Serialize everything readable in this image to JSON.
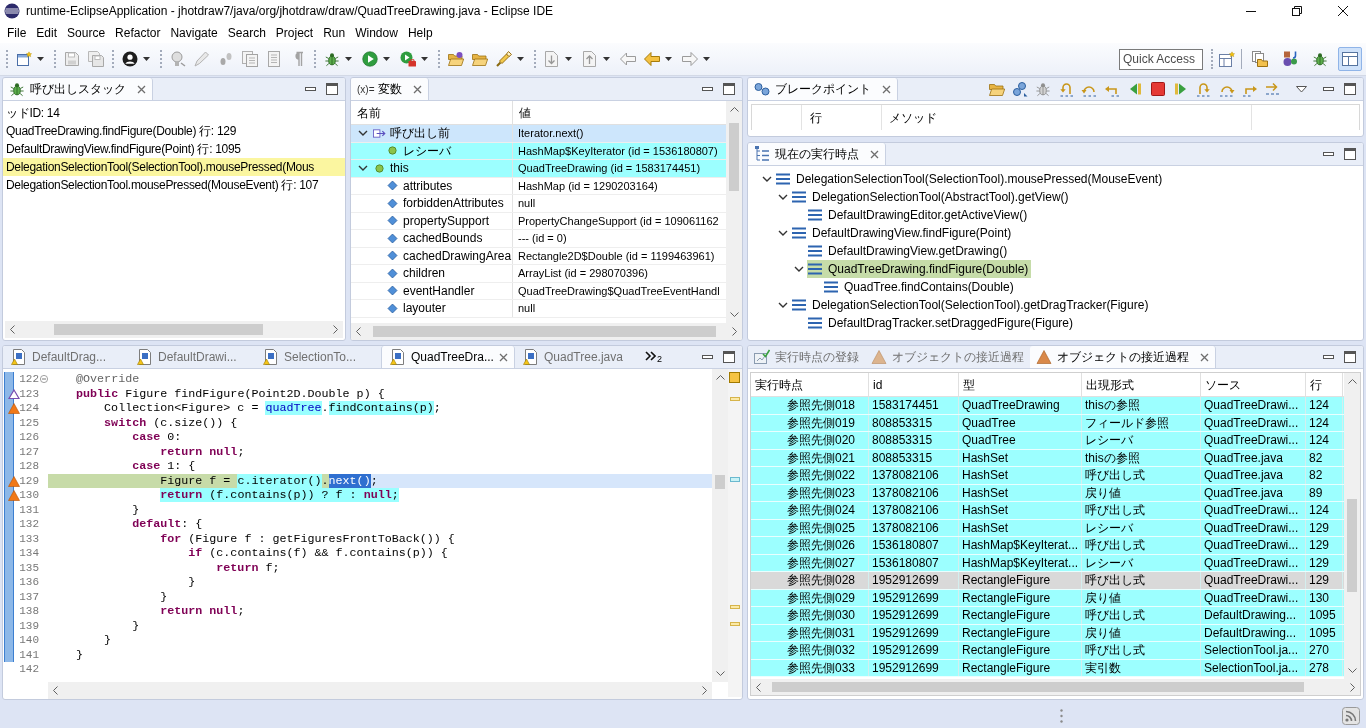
{
  "window": {
    "title": "runtime-EclipseApplication - jhotdraw7/java/org/jhotdraw/draw/QuadTreeDrawing.java - Eclipse IDE"
  },
  "menu": [
    "File",
    "Edit",
    "Source",
    "Refactor",
    "Navigate",
    "Search",
    "Project",
    "Run",
    "Window",
    "Help"
  ],
  "toolbar": {
    "quick_access": {
      "placeholder": "Quick Access"
    },
    "perspectives": [
      {
        "selected": false
      },
      {
        "selected": false
      },
      {
        "selected": false
      },
      {
        "selected": true
      }
    ]
  },
  "call_stack": {
    "title": "呼び出しスタック",
    "frames": [
      {
        "text": "ッドID: 14",
        "selected": false
      },
      {
        "text": "QuadTreeDrawing.findFigure(Double) 行: 129",
        "selected": false
      },
      {
        "text": "DefaultDrawingView.findFigure(Point) 行: 1095",
        "selected": false
      },
      {
        "text": "DelegationSelectionTool(SelectionTool).mousePressed(Mous",
        "selected": true
      },
      {
        "text": "DelegationSelectionTool.mousePressed(MouseEvent) 行: 107",
        "selected": false
      }
    ]
  },
  "variables": {
    "glyph": "(x)=",
    "title": "変数",
    "columns": [
      "名前",
      "値"
    ],
    "rows": [
      {
        "kind": "return",
        "name": "呼び出し前",
        "value": "Iterator.next()",
        "selected": true,
        "highlighted": false,
        "expanded": true,
        "children": [
          {
            "kind": "local",
            "name": "レシーバ",
            "value": "HashMap$KeyIterator (id = 1536180807)",
            "selected": false,
            "highlighted": true
          }
        ]
      },
      {
        "kind": "local",
        "name": "this",
        "value": "QuadTreeDrawing (id = 1583174451)",
        "selected": false,
        "highlighted": true,
        "expanded": true,
        "children": [
          {
            "kind": "field",
            "name": "attributes",
            "value": "HashMap (id = 1290203164)",
            "selected": false,
            "highlighted": false
          },
          {
            "kind": "field",
            "name": "forbiddenAttributes",
            "value": "null",
            "selected": false,
            "highlighted": false
          },
          {
            "kind": "field",
            "name": "propertySupport",
            "value": "PropertyChangeSupport (id = 109061162",
            "selected": false,
            "highlighted": false
          },
          {
            "kind": "field",
            "name": "cachedBounds",
            "value": "--- (id = 0)",
            "selected": false,
            "highlighted": false
          },
          {
            "kind": "field",
            "name": "cachedDrawingArea",
            "value": "Rectangle2D$Double (id = 1199463961)",
            "selected": false,
            "highlighted": false
          },
          {
            "kind": "field",
            "name": "children",
            "value": "ArrayList (id = 298070396)",
            "selected": false,
            "highlighted": false
          },
          {
            "kind": "field",
            "name": "eventHandler",
            "value": "QuadTreeDrawing$QuadTreeEventHandl",
            "selected": false,
            "highlighted": false
          },
          {
            "kind": "field",
            "name": "layouter",
            "value": "null",
            "selected": false,
            "highlighted": false
          }
        ]
      }
    ]
  },
  "breakpoints": {
    "title": "ブレークポイント",
    "columns": [
      "行",
      "メソッド"
    ]
  },
  "execution_point": {
    "title": "現在の実行時点",
    "tree": [
      {
        "label": "DelegationSelectionTool(SelectionTool).mousePressed(MouseEvent)",
        "selected": false,
        "expanded": true,
        "children": [
          {
            "label": "DelegationSelectionTool(AbstractTool).getView()",
            "selected": false,
            "expanded": true,
            "children": [
              {
                "label": "DefaultDrawingEditor.getActiveView()",
                "selected": false
              }
            ]
          },
          {
            "label": "DefaultDrawingView.findFigure(Point)",
            "selected": false,
            "expanded": true,
            "children": [
              {
                "label": "DefaultDrawingView.getDrawing()",
                "selected": false
              },
              {
                "label": "QuadTreeDrawing.findFigure(Double)",
                "selected": true,
                "expanded": true,
                "children": [
                  {
                    "label": "QuadTree.findContains(Double)",
                    "selected": false
                  }
                ]
              }
            ]
          },
          {
            "label": "DelegationSelectionTool(SelectionTool).getDragTracker(Figure)",
            "selected": false,
            "expanded": true,
            "children": [
              {
                "label": "DefaultDragTracker.setDraggedFigure(Figure)",
                "selected": false
              }
            ]
          }
        ]
      }
    ]
  },
  "editor": {
    "tabs": [
      {
        "label": "DefaultDrag...",
        "selected": false
      },
      {
        "label": "DefaultDrawi...",
        "selected": false
      },
      {
        "label": "SelectionTo...",
        "selected": false
      },
      {
        "label": "QuadTreeDra...",
        "selected": true
      },
      {
        "label": "QuadTree.java",
        "selected": false
      }
    ],
    "hidden_tab_count": "2",
    "lines": [
      {
        "number": "122",
        "kind": "fold",
        "current": false,
        "tokens": [
          {
            "text": "    @Override",
            "kind": "annotation"
          }
        ]
      },
      {
        "number": "123",
        "kind": "override",
        "current": false,
        "tokens": [
          {
            "text": "    public",
            "kind": "keyword"
          },
          {
            "text": " Figure findFigure(Point2D.Double p) {",
            "kind": "plain"
          }
        ]
      },
      {
        "number": "124",
        "kind": "approach",
        "current": false,
        "tokens": [
          {
            "text": "        Collection<Figure> c = ",
            "kind": "plain"
          },
          {
            "text": "quadTree",
            "kind": "field-match"
          },
          {
            "text": ".",
            "kind": "plain"
          },
          {
            "text": "findContains(p)",
            "kind": "plain-match"
          },
          {
            "text": ";",
            "kind": "plain"
          }
        ]
      },
      {
        "number": "125",
        "kind": "plain",
        "current": false,
        "tokens": [
          {
            "text": "        switch",
            "kind": "keyword"
          },
          {
            "text": " (c.size()) {",
            "kind": "plain"
          }
        ]
      },
      {
        "number": "126",
        "kind": "plain",
        "current": false,
        "tokens": [
          {
            "text": "            case",
            "kind": "keyword"
          },
          {
            "text": " 0:",
            "kind": "plain"
          }
        ]
      },
      {
        "number": "127",
        "kind": "plain",
        "current": false,
        "tokens": [
          {
            "text": "                return null",
            "kind": "keyword"
          },
          {
            "text": ";",
            "kind": "plain"
          }
        ]
      },
      {
        "number": "128",
        "kind": "plain",
        "current": false,
        "tokens": [
          {
            "text": "            case",
            "kind": "keyword"
          },
          {
            "text": " 1: {",
            "kind": "plain"
          }
        ]
      },
      {
        "number": "129",
        "kind": "approach",
        "current": true,
        "tokens": [
          {
            "text": "                Figure f = ",
            "kind": "plain-current"
          },
          {
            "text": "c.iterator()",
            "kind": "plain-match"
          },
          {
            "text": ".",
            "kind": "plain-current"
          },
          {
            "text": "next()",
            "kind": "plain-selection"
          },
          {
            "text": ";",
            "kind": "plain"
          }
        ]
      },
      {
        "number": "130",
        "kind": "approach",
        "current": false,
        "tokens": [
          {
            "text": "                return",
            "kind": "keyword-match"
          },
          {
            "text": " (f.contains(p)) ? f : ",
            "kind": "plain-match"
          },
          {
            "text": "null",
            "kind": "keyword-match"
          },
          {
            "text": ";",
            "kind": "plain-match"
          }
        ]
      },
      {
        "number": "131",
        "kind": "plain",
        "current": false,
        "tokens": [
          {
            "text": "            }",
            "kind": "plain"
          }
        ]
      },
      {
        "number": "132",
        "kind": "plain",
        "current": false,
        "tokens": [
          {
            "text": "            default",
            "kind": "keyword"
          },
          {
            "text": ": {",
            "kind": "plain"
          }
        ]
      },
      {
        "number": "133",
        "kind": "plain",
        "current": false,
        "tokens": [
          {
            "text": "                for",
            "kind": "keyword"
          },
          {
            "text": " (Figure f : getFiguresFrontToBack()) {",
            "kind": "plain"
          }
        ]
      },
      {
        "number": "134",
        "kind": "plain",
        "current": false,
        "tokens": [
          {
            "text": "                    if",
            "kind": "keyword"
          },
          {
            "text": " (c.contains(f) && f.contains(p)) {",
            "kind": "plain"
          }
        ]
      },
      {
        "number": "135",
        "kind": "plain",
        "current": false,
        "tokens": [
          {
            "text": "                        return",
            "kind": "keyword"
          },
          {
            "text": " f;",
            "kind": "plain"
          }
        ]
      },
      {
        "number": "136",
        "kind": "plain",
        "current": false,
        "tokens": [
          {
            "text": "                    }",
            "kind": "plain"
          }
        ]
      },
      {
        "number": "137",
        "kind": "plain",
        "current": false,
        "tokens": [
          {
            "text": "                }",
            "kind": "plain"
          }
        ]
      },
      {
        "number": "138",
        "kind": "plain",
        "current": false,
        "tokens": [
          {
            "text": "                return null",
            "kind": "keyword"
          },
          {
            "text": ";",
            "kind": "plain"
          }
        ]
      },
      {
        "number": "139",
        "kind": "plain",
        "current": false,
        "tokens": [
          {
            "text": "            }",
            "kind": "plain"
          }
        ]
      },
      {
        "number": "140",
        "kind": "plain",
        "current": false,
        "tokens": [
          {
            "text": "        }",
            "kind": "plain"
          }
        ]
      },
      {
        "number": "141",
        "kind": "plain",
        "current": false,
        "tokens": [
          {
            "text": "    }",
            "kind": "plain"
          }
        ]
      },
      {
        "number": "142",
        "kind": "plain",
        "current": false
      }
    ]
  },
  "approach": {
    "tabs": [
      {
        "label": "実行時点の登録",
        "kind": "register",
        "selected": false
      },
      {
        "label": "オブジェクトの接近過程",
        "kind": "approach",
        "selected": false
      },
      {
        "label": "オブジェクトの接近過程",
        "kind": "approach",
        "selected": true
      }
    ],
    "columns": [
      "実行時点",
      "id",
      "型",
      "出現形式",
      "ソース",
      "行"
    ],
    "rows": [
      {
        "cells": [
          "参照先側018",
          "1583174451",
          "QuadTreeDrawing",
          "thisの参照",
          "QuadTreeDrawi...",
          "124"
        ],
        "selected": false
      },
      {
        "cells": [
          "参照先側019",
          "808853315",
          "QuadTree",
          "フィールド参照",
          "QuadTreeDrawi...",
          "124"
        ],
        "selected": false
      },
      {
        "cells": [
          "参照先側020",
          "808853315",
          "QuadTree",
          "レシーバ",
          "QuadTreeDrawi...",
          "124"
        ],
        "selected": false
      },
      {
        "cells": [
          "参照先側021",
          "808853315",
          "HashSet",
          "thisの参照",
          "QuadTree.java",
          "82"
        ],
        "selected": false
      },
      {
        "cells": [
          "参照先側022",
          "1378082106",
          "HashSet",
          "呼び出し式",
          "QuadTree.java",
          "82"
        ],
        "selected": false
      },
      {
        "cells": [
          "参照先側023",
          "1378082106",
          "HashSet",
          "戻り値",
          "QuadTree.java",
          "89"
        ],
        "selected": false
      },
      {
        "cells": [
          "参照先側024",
          "1378082106",
          "HashSet",
          "呼び出し式",
          "QuadTreeDrawi...",
          "124"
        ],
        "selected": false
      },
      {
        "cells": [
          "参照先側025",
          "1378082106",
          "HashSet",
          "レシーバ",
          "QuadTreeDrawi...",
          "129"
        ],
        "selected": false
      },
      {
        "cells": [
          "参照先側026",
          "1536180807",
          "HashMap$KeyIterat...",
          "呼び出し式",
          "QuadTreeDrawi...",
          "129"
        ],
        "selected": false
      },
      {
        "cells": [
          "参照先側027",
          "1536180807",
          "HashMap$KeyIterat...",
          "レシーバ",
          "QuadTreeDrawi...",
          "129"
        ],
        "selected": false
      },
      {
        "cells": [
          "参照先側028",
          "1952912699",
          "RectangleFigure",
          "呼び出し式",
          "QuadTreeDrawi...",
          "129"
        ],
        "selected": true
      },
      {
        "cells": [
          "参照先側029",
          "1952912699",
          "RectangleFigure",
          "戻り値",
          "QuadTreeDrawi...",
          "130"
        ],
        "selected": false
      },
      {
        "cells": [
          "参照先側030",
          "1952912699",
          "RectangleFigure",
          "呼び出し式",
          "DefaultDrawing...",
          "1095"
        ],
        "selected": false
      },
      {
        "cells": [
          "参照先側031",
          "1952912699",
          "RectangleFigure",
          "戻り値",
          "DefaultDrawing...",
          "1095"
        ],
        "selected": false
      },
      {
        "cells": [
          "参照先側032",
          "1952912699",
          "RectangleFigure",
          "呼び出し式",
          "SelectionTool.ja...",
          "270"
        ],
        "selected": false
      },
      {
        "cells": [
          "参照先側033",
          "1952912699",
          "RectangleFigure",
          "実引数",
          "SelectionTool.ja...",
          "278"
        ],
        "selected": false
      }
    ]
  }
}
